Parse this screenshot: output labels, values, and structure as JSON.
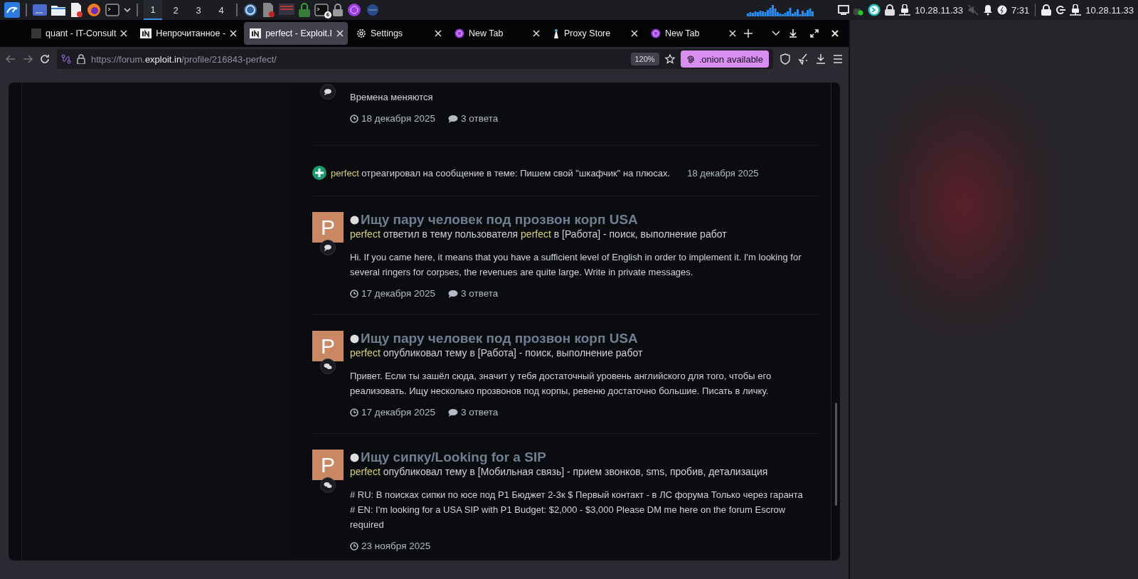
{
  "taskbar": {
    "workspaces": [
      {
        "label": "1",
        "selected": true
      },
      {
        "label": "2",
        "selected": false
      },
      {
        "label": "3",
        "selected": false
      },
      {
        "label": "4",
        "selected": false
      }
    ],
    "terminal_badge": "6",
    "tray_ip": "10.28.11.33",
    "clock": "7:31",
    "panel_ip": "10.28.11.33"
  },
  "tabs": [
    {
      "title": "quant - IT-Consult",
      "kind": "square",
      "selected": false
    },
    {
      "title": "Непрочитанное -",
      "kind": "in",
      "selected": false
    },
    {
      "title": "perfect - Exploit.I",
      "kind": "in",
      "selected": true
    },
    {
      "title": "Settings",
      "kind": "gear",
      "selected": false
    },
    {
      "title": "New Tab",
      "kind": "tor",
      "selected": false
    },
    {
      "title": "Proxy Store",
      "kind": "proxy",
      "selected": false
    },
    {
      "title": "New Tab",
      "kind": "tor",
      "selected": false
    }
  ],
  "url_bar": {
    "prefix": "https://forum.",
    "domain": "exploit.in",
    "path": "/profile/216843-perfect/",
    "zoom": "120%",
    "onion_badge": ".onion available"
  },
  "feed": [
    {
      "kind": "reply",
      "body": "Времена меняются",
      "date": "18 декабря 2025",
      "replies": "3 ответа"
    },
    {
      "kind": "reaction",
      "user": "perfect",
      "text": "отреагировал на сообщение в теме: Пишем свой \"шкафчик\" на плюсах.",
      "date": "18 декабря 2025"
    },
    {
      "kind": "reply",
      "avatar": "P",
      "title": "Ищу пару человек под прозвон корп USA",
      "meta": [
        {
          "kind": "user",
          "text": "perfect"
        },
        {
          "kind": "plain",
          "text": "ответил в тему пользователя"
        },
        {
          "kind": "user",
          "text": "perfect"
        },
        {
          "kind": "plain",
          "text": "в [Работа] - поиск, выполнение работ"
        }
      ],
      "body": "Hi. If you came here, it means that you have a sufficient level of English in order to implement it. I'm looking for several ringers for corpses, the revenues are quite large. Write in private messages.",
      "date": "17 декабря 2025",
      "replies": "3 ответа"
    },
    {
      "kind": "topic",
      "avatar": "P",
      "title": "Ищу пару человек под прозвон корп USA",
      "meta": [
        {
          "kind": "user",
          "text": "perfect"
        },
        {
          "kind": "plain",
          "text": "опубликовал тему в [Работа] - поиск, выполнение работ"
        }
      ],
      "body": "Привет. Если ты зашёл сюда, значит у тебя достаточный уровень английского для того, чтобы его реализовать. Ищу несколько прозвонов под корпы, ревеню достаточно большие. Писать в личку.",
      "date": "17 декабря 2025",
      "replies": "3 ответа"
    },
    {
      "kind": "topic",
      "avatar": "P",
      "title": "Ищу сипку/Looking for a SIP",
      "meta": [
        {
          "kind": "user",
          "text": "perfect"
        },
        {
          "kind": "plain",
          "text": "опубликовал тему в [Мобильная связь] - прием звонков, sms, пробив, детализация"
        }
      ],
      "body": "# RU: В поисках сипки по юсе под P1 Бюджет 2-3к $ Первый контакт - в ЛС форума Только через гаранта # EN: I'm looking for a USA SIP with P1 Budget: $2,000 - $3,000 Please DM me here on the forum Escrow required",
      "date": "23 ноября 2025"
    }
  ]
}
